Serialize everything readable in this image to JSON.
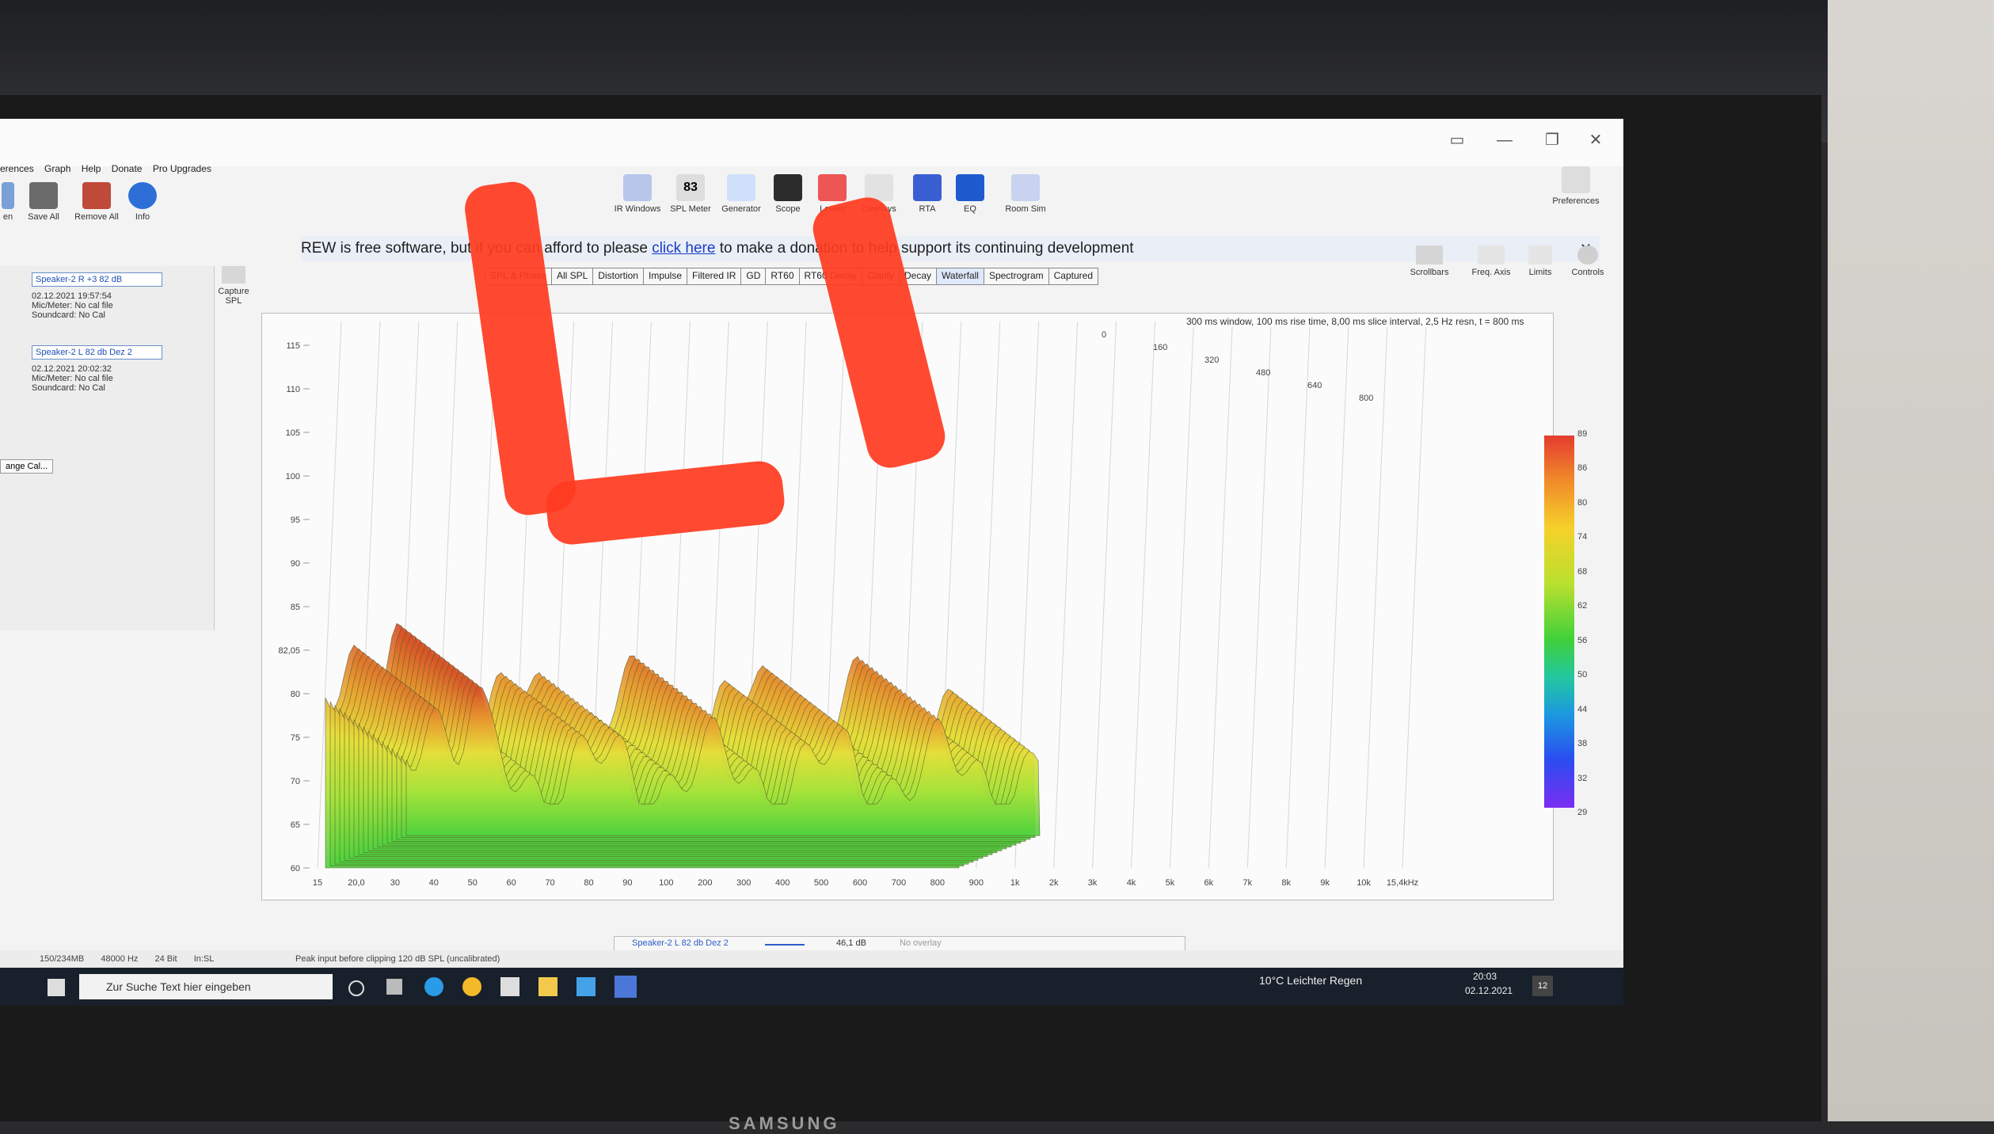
{
  "window": {
    "menu": [
      "erences",
      "Graph",
      "Help",
      "Donate",
      "Pro Upgrades"
    ],
    "toolbar_left": [
      {
        "label": "en"
      },
      {
        "label": "Save All"
      },
      {
        "label": "Remove All"
      },
      {
        "label": "Info"
      }
    ],
    "toolbar_center": [
      {
        "label": "IR Windows"
      },
      {
        "label": "SPL Meter",
        "value": "83"
      },
      {
        "label": "Generator"
      },
      {
        "label": "Scope"
      },
      {
        "label": "Levels"
      },
      {
        "label": "Overlays"
      },
      {
        "label": "RTA"
      },
      {
        "label": "EQ"
      },
      {
        "label": "Room Sim"
      }
    ],
    "preferences_label": "Preferences",
    "right_tools": [
      "Scrollbars",
      "Freq. Axis",
      "Limits",
      "Controls"
    ],
    "donation": {
      "before": "REW is free software, but if you can afford to please",
      "link": "click here",
      "after": "to make a donation to help support its continuing development"
    },
    "graph_tabs": [
      "SPL & Phase",
      "All SPL",
      "Distortion",
      "Impulse",
      "Filtered IR",
      "GD",
      "RT60",
      "RT60 Decay",
      "Clarity",
      "Decay",
      "Waterfall",
      "Spectrogram",
      "Captured"
    ],
    "active_tab": "Waterfall",
    "capture_label": "Capture",
    "spl_label": "SPL",
    "measurements": [
      {
        "name": "Speaker-2 R +3 82 dB",
        "date": "02.12.2021 19:57:54",
        "mic": "Mic/Meter: No cal file",
        "sound": "Soundcard: No Cal"
      },
      {
        "name": "Speaker-2 L 82 db Dez 2",
        "date": "02.12.2021 20:02:32",
        "mic": "Mic/Meter: No cal file",
        "sound": "Soundcard: No Cal"
      }
    ],
    "range_cal_label": "ange Cal...",
    "plot_info": "300 ms window, 100 ms rise time, 8,00 ms slice interval, 2,5 Hz resn, t = 800 ms",
    "y_ticks": [
      "115",
      "110",
      "105",
      "100",
      "95",
      "90",
      "85",
      "82,05",
      "80",
      "75",
      "70",
      "65",
      "60"
    ],
    "x_ticks": [
      "15",
      "20,0",
      "30",
      "40",
      "50",
      "60",
      "70",
      "80",
      "90",
      "100",
      "200",
      "300",
      "400",
      "500",
      "600",
      "700",
      "800",
      "900",
      "1k",
      "2k",
      "3k",
      "4k",
      "5k",
      "6k",
      "7k",
      "8k",
      "9k",
      "10k",
      "15,4kHz"
    ],
    "time_ticks": [
      "0",
      "160",
      "320",
      "480",
      "640",
      "800"
    ],
    "colorbar_ticks": [
      "89",
      "86",
      "80",
      "74",
      "68",
      "62",
      "56",
      "50",
      "44",
      "38",
      "32",
      "29"
    ],
    "legend": {
      "name": "Speaker-2 L 82 db Dez 2",
      "value": "46,1 dB",
      "overlay": "No overlay"
    },
    "status": [
      "150/234MB",
      "48000 Hz",
      "24 Bit",
      "In:SL",
      "Peak input before clipping 120 dB SPL (uncalibrated)"
    ]
  },
  "taskbar": {
    "search_placeholder": "Zur Suche Text hier eingeben",
    "weather": "10°C  Leichter Regen",
    "time": "20:03",
    "date": "02.12.2021",
    "notifications": "12"
  },
  "monitor_brand": "SAMSUNG"
}
